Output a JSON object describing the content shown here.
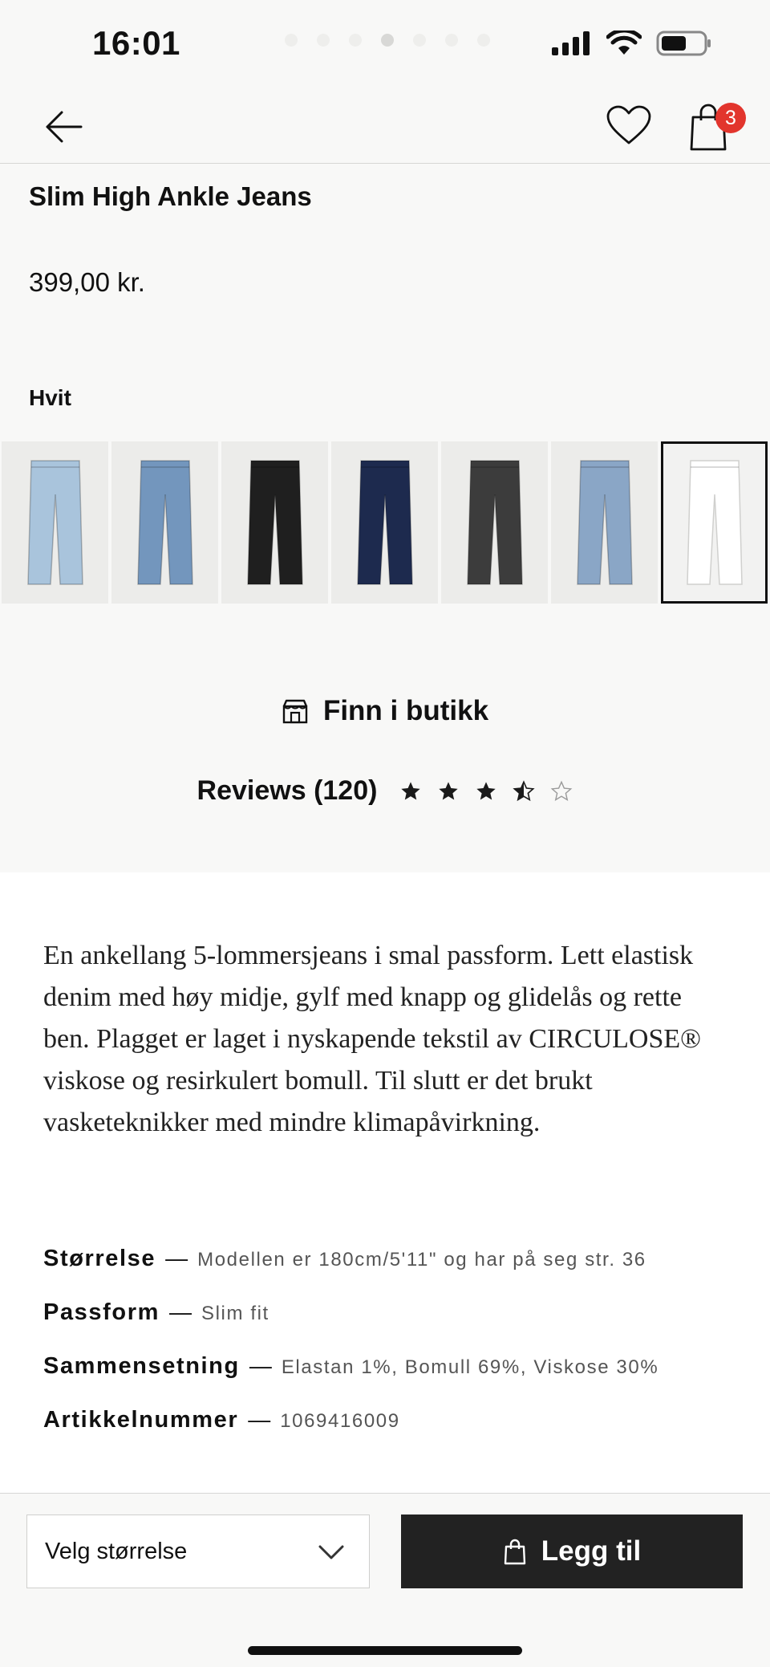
{
  "status": {
    "time": "16:01",
    "icons": [
      "signal-icon",
      "wifi-icon",
      "battery-icon"
    ]
  },
  "nav": {
    "back_icon": "arrow-left-icon",
    "favorite_icon": "heart-icon",
    "bag_icon": "shopping-bag-icon",
    "bag_count": "3"
  },
  "product": {
    "title": "Slim High Ankle Jeans",
    "price": "399,00 kr.",
    "color_name": "Hvit",
    "swatches": [
      {
        "color": "#a9c4dc",
        "selected": false
      },
      {
        "color": "#7396bd",
        "selected": false
      },
      {
        "color": "#1f1f1f",
        "selected": false
      },
      {
        "color": "#1d2a4e",
        "selected": false
      },
      {
        "color": "#3c3c3c",
        "selected": false
      },
      {
        "color": "#8aa6c6",
        "selected": false
      },
      {
        "color": "#ffffff",
        "selected": true
      }
    ]
  },
  "store": {
    "label": "Finn i butikk",
    "icon": "store-icon"
  },
  "reviews": {
    "label": "Reviews (120)",
    "rating": 3.5,
    "max": 5
  },
  "description": "En ankellang 5-lommersjeans i smal passform. Lett elastisk denim med høy midje, gylf med knapp og glidelås og rette ben. Plagget er laget i nyskapende tekstil av CIRCULOSE® viskose og resirkulert bomull. Til slutt er det brukt vasketeknikker med mindre klimapåvirkning.",
  "specs": [
    {
      "key": "Størrelse",
      "dash": "—",
      "value": "Modellen er 180cm/5'11\" og har på seg str. 36"
    },
    {
      "key": "Passform",
      "dash": "—",
      "value": "Slim fit"
    },
    {
      "key": "Sammensetning",
      "dash": "—",
      "value": "Elastan 1%, Bomull 69%, Viskose 30%"
    },
    {
      "key": "Artikkelnummer",
      "dash": "—",
      "value": "1069416009"
    }
  ],
  "bottom": {
    "size_select_label": "Velg størrelse",
    "add_button_label": "Legg til"
  }
}
